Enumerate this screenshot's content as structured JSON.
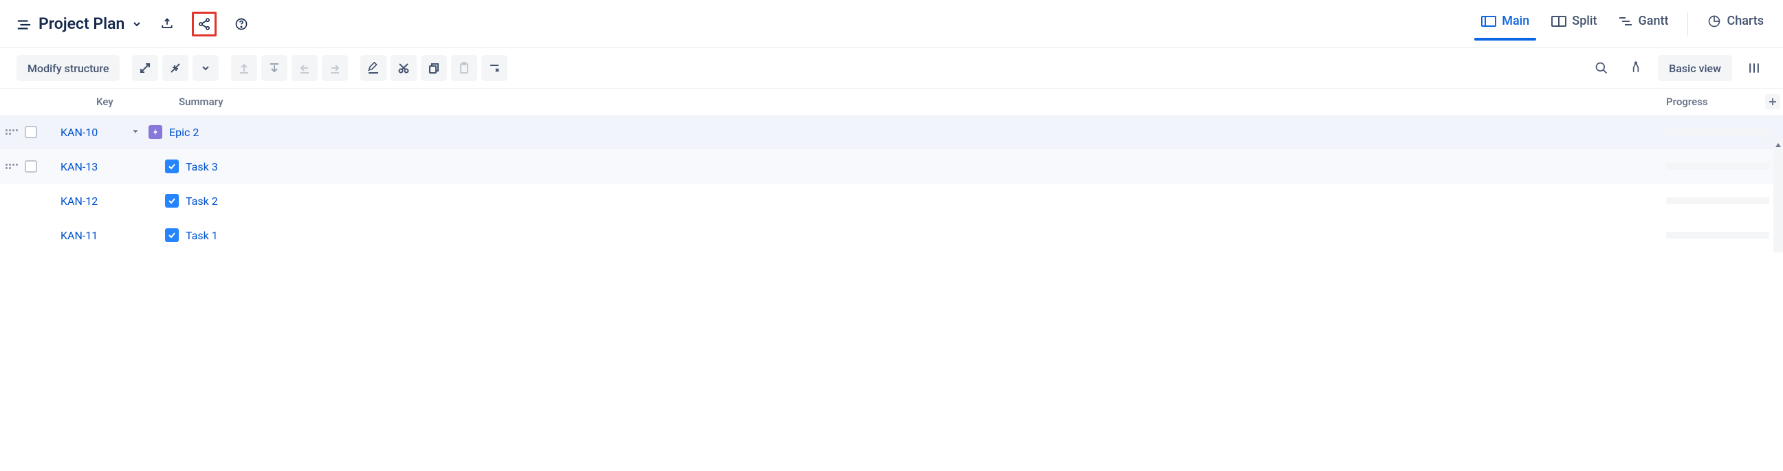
{
  "header": {
    "title": "Project Plan"
  },
  "view_tabs": [
    {
      "label": "Main",
      "active": true,
      "icon": "panel-main-icon"
    },
    {
      "label": "Split",
      "active": false,
      "icon": "panel-split-icon"
    },
    {
      "label": "Gantt",
      "active": false,
      "icon": "gantt-icon"
    },
    {
      "label": "Charts",
      "active": false,
      "icon": "chart-pie-icon",
      "separated": true
    }
  ],
  "toolbar": {
    "modify_label": "Modify structure",
    "basic_view_label": "Basic view"
  },
  "columns": {
    "key": "Key",
    "summary": "Summary",
    "progress": "Progress"
  },
  "rows": [
    {
      "key": "KAN-10",
      "summary": "Epic 2",
      "type": "epic",
      "indent": 0,
      "expandable": true,
      "hover": true
    },
    {
      "key": "KAN-13",
      "summary": "Task 3",
      "type": "task",
      "indent": 1,
      "expandable": false,
      "hover": true
    },
    {
      "key": "KAN-12",
      "summary": "Task 2",
      "type": "task",
      "indent": 1,
      "expandable": false,
      "hover": false
    },
    {
      "key": "KAN-11",
      "summary": "Task 1",
      "type": "task",
      "indent": 1,
      "expandable": false,
      "hover": false
    }
  ]
}
